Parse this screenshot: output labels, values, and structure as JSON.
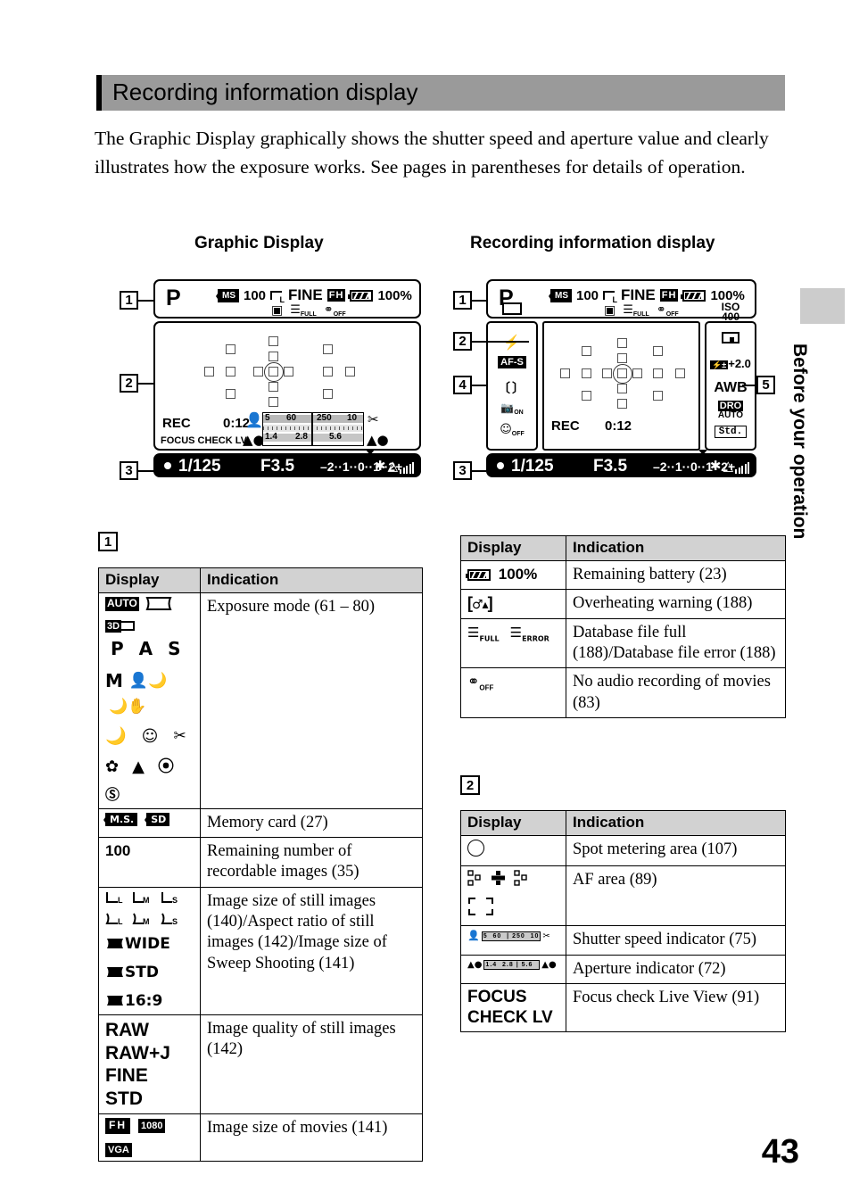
{
  "page": {
    "number": "43",
    "section_title": "Recording information display",
    "intro": "The Graphic Display graphically shows the shutter speed and aperture value and clearly illustrates how the exposure works. See pages in parentheses for details of operation.",
    "margin_tab": "Before your operation",
    "margin_tab_color": "#cccccc",
    "header_bg": "#9a9a9a"
  },
  "diagrams": {
    "left": {
      "caption": "Graphic Display",
      "callouts": [
        "1",
        "2",
        "3"
      ],
      "top_bar": {
        "exposure_mode": "P",
        "memory_card": "MS",
        "remaining_images": "100",
        "image_size": "L",
        "quality": "FINE",
        "movie_size": "FH",
        "battery_pct": "100%",
        "row2_icons": [
          "sd-card-icon",
          "database-full-icon",
          "mic-off-icon"
        ],
        "row2_labels": [
          "",
          "FULL",
          "OFF"
        ]
      },
      "middle": {
        "rec_label": "REC",
        "timer": "0:12",
        "focus_check": "FOCUS CHECK LV",
        "shutter_scale": [
          "5",
          "60",
          "250",
          "10"
        ],
        "aperture_scale": [
          "1.4",
          "2.8",
          "5.6"
        ]
      },
      "bottom_bar": {
        "shutter_speed": "1/125",
        "aperture": "F3.5",
        "ev_scale": "–2··1··0··1··2+",
        "tail_icons": [
          "flash-icon",
          "steadyshot-icon",
          "signal-bars-icon"
        ]
      }
    },
    "right": {
      "caption": "Recording information display",
      "callouts": [
        "1",
        "2",
        "3",
        "4",
        "5"
      ],
      "top_bar": {
        "exposure_mode": "P",
        "memory_card": "MS",
        "remaining_images": "100",
        "image_size": "L",
        "quality": "FINE",
        "movie_size": "FH",
        "battery_pct": "100%"
      },
      "left_column": {
        "items": [
          {
            "name": "drive-mode-icon",
            "label": ""
          },
          {
            "name": "flash-mode-icon",
            "label": ""
          },
          {
            "name": "af-mode-badge",
            "label": "AF-S"
          },
          {
            "name": "af-area-icon",
            "label": ""
          },
          {
            "name": "face-detect-icon",
            "label": "ON"
          },
          {
            "name": "smile-shutter-icon",
            "label": "OFF"
          }
        ]
      },
      "right_column": {
        "items": [
          {
            "name": "iso-value",
            "label": "ISO 400"
          },
          {
            "name": "metering-mode-icon",
            "label": ""
          },
          {
            "name": "flash-compensation",
            "label": "+2.0"
          },
          {
            "name": "white-balance",
            "label": "AWB"
          },
          {
            "name": "dro-mode",
            "label": "DRO AUTO"
          },
          {
            "name": "creative-style",
            "label": "Std."
          }
        ]
      },
      "middle": {
        "rec_label": "REC",
        "timer": "0:12"
      },
      "bottom_bar": {
        "shutter_speed": "1/125",
        "aperture": "F3.5",
        "ev_scale": "–2··1··0··1··2+"
      }
    }
  },
  "tables": [
    {
      "id": "table-1-left",
      "section": "1",
      "columns": [
        "Display",
        "Indication"
      ],
      "rows": [
        {
          "display_icons": [
            "AUTO",
            "sweep-panorama-icon",
            "3D-sweep-icon",
            "P",
            "A",
            "S",
            "M",
            "portrait-night-icon",
            "hand-held-twilight-icon",
            "night-view-icon",
            "sunset-icon",
            "sports-action-icon",
            "macro-icon",
            "landscape-icon",
            "anti-blur-icon",
            "flash-off-icon"
          ],
          "display_text": "",
          "indication": "Exposure mode (61 – 80)"
        },
        {
          "display_icons": [
            "memory-stick-icon",
            "sd-card-icon"
          ],
          "display_text": "M.S.   SD",
          "indication": "Memory card (27)"
        },
        {
          "display_icons": [],
          "display_text": "100",
          "indication": "Remaining number of recordable images (35)"
        },
        {
          "display_icons": [
            "size-L-icon",
            "size-M-icon",
            "size-S-icon",
            "ratio-L-icon",
            "ratio-M-icon",
            "ratio-S-icon"
          ],
          "display_text": "WIDE  STD  16:9",
          "indication": "Image size of still images (140)/Aspect ratio of still images (142)/Image size of Sweep Shooting (141)"
        },
        {
          "display_icons": [],
          "display_text": "RAW RAW+J FINE STD",
          "indication": "Image quality of still images (142)"
        },
        {
          "display_icons": [
            "movie-fh-icon",
            "movie-1080-icon",
            "movie-vga-icon"
          ],
          "display_text": "FH  1080  VGA",
          "indication": "Image size of movies (141)"
        }
      ]
    },
    {
      "id": "table-1-right",
      "section": "1",
      "columns": [
        "Display",
        "Indication"
      ],
      "rows": [
        {
          "display_icons": [
            "battery-icon"
          ],
          "display_text": "100%",
          "indication": "Remaining battery (23)"
        },
        {
          "display_icons": [
            "overheating-icon"
          ],
          "display_text": "",
          "indication": "Overheating warning (188)"
        },
        {
          "display_icons": [
            "database-full-icon",
            "database-error-icon"
          ],
          "display_text": "FULL  ERROR",
          "indication": "Database file full (188)/Database file error (188)"
        },
        {
          "display_icons": [
            "mic-off-icon"
          ],
          "display_text": "OFF",
          "indication": "No audio recording of movies (83)"
        }
      ]
    },
    {
      "id": "table-2",
      "section": "2",
      "columns": [
        "Display",
        "Indication"
      ],
      "rows": [
        {
          "display_icons": [
            "spot-metering-circle-icon"
          ],
          "display_text": "",
          "indication": "Spot metering area (107)"
        },
        {
          "display_icons": [
            "af-area-dots-icon",
            "af-area-cross-icon",
            "af-area-bracket-icon"
          ],
          "display_text": "",
          "indication": "AF area (89)"
        },
        {
          "display_icons": [
            "shutter-speed-scale-icon"
          ],
          "display_text": "5  60  250  10",
          "indication": "Shutter speed indicator (75)"
        },
        {
          "display_icons": [
            "aperture-scale-icon"
          ],
          "display_text": "1.4  2.8  5.6",
          "indication": "Aperture indicator (72)"
        },
        {
          "display_icons": [],
          "display_text": "FOCUS CHECK LV",
          "indication": "Focus check Live View (91)"
        }
      ]
    }
  ]
}
